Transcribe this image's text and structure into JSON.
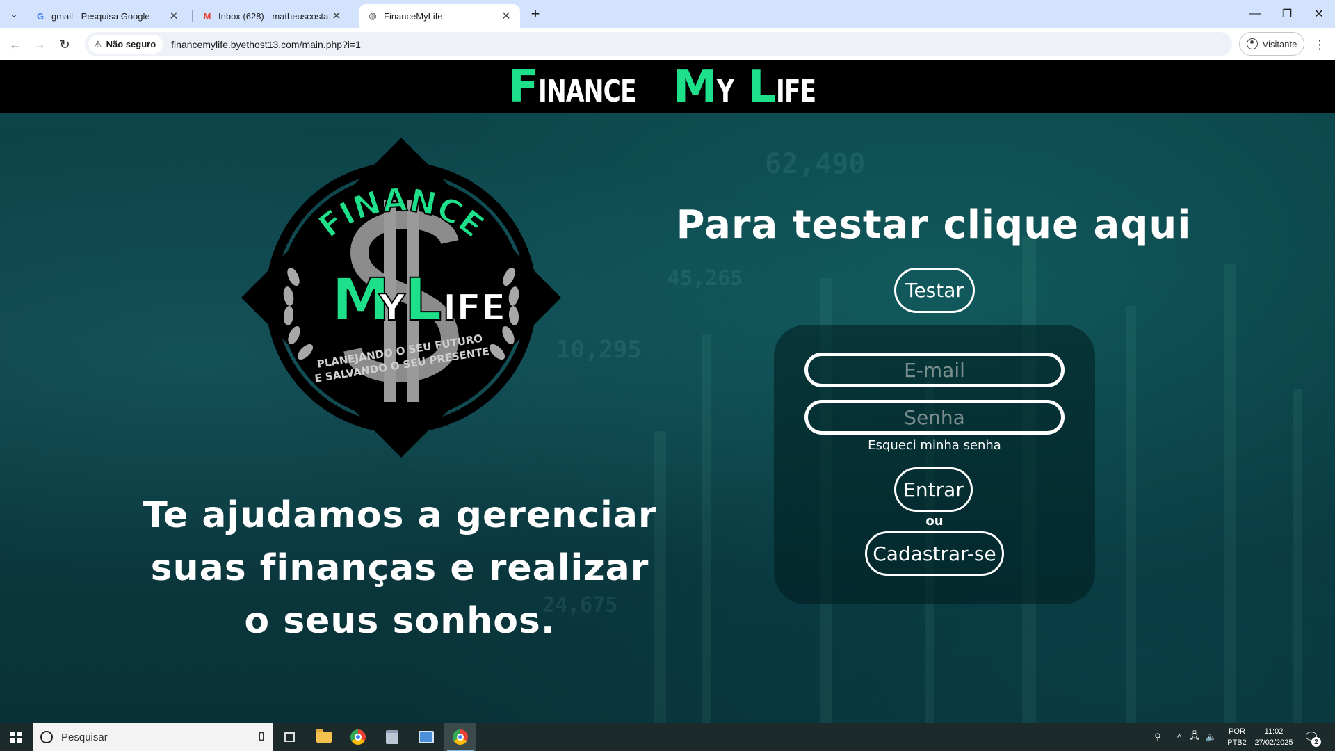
{
  "browser": {
    "tabs": [
      {
        "title": "gmail - Pesquisa Google",
        "favicon": "google-g-icon",
        "active": false
      },
      {
        "title": "Inbox (628) - matheuscosta.mc",
        "favicon": "gmail-icon",
        "active": false
      },
      {
        "title": "FinanceMyLife",
        "favicon": "globe-icon",
        "active": true
      }
    ],
    "security_label": "Não seguro",
    "url": "financemylife.byethost13.com/main.php?i=1",
    "profile_label": "Visitante"
  },
  "site": {
    "brand_parts": [
      {
        "cap": "F",
        "rest": "INANCE",
        "cap_color": "#1fe08a"
      },
      {
        "cap": "M",
        "rest": "Y",
        "cap_color": "#1fe08a"
      },
      {
        "cap": "L",
        "rest": "IFE",
        "cap_color": "#1fe08a"
      }
    ],
    "emblem": {
      "arc_text": "FINANCE",
      "title_m": "M",
      "title_y": "Y",
      "title_l": "L",
      "title_rest": "IFE",
      "motto_line1": "PLANEJANDO O SEU FUTURO",
      "motto_line2": "E SALVANDO O SEU PRESENTE"
    },
    "tagline_lines": [
      "Te ajudamos a gerenciar",
      "suas finanças e realizar",
      "o seus sonhos."
    ],
    "test_heading": "Para testar clique aqui",
    "test_button": "Testar",
    "login": {
      "email_placeholder": "E-mail",
      "password_placeholder": "Senha",
      "forgot_label": "Esqueci minha senha",
      "submit_label": "Entrar",
      "or_label": "ou",
      "register_label": "Cadastrar-se"
    },
    "colors": {
      "accent": "#1fe08a",
      "header_bg": "#000000"
    }
  },
  "taskbar": {
    "search_placeholder": "Pesquisar",
    "lang_line1": "POR",
    "lang_line2": "PTB2",
    "time": "11:02",
    "date": "27/02/2025",
    "notification_count": "2"
  }
}
